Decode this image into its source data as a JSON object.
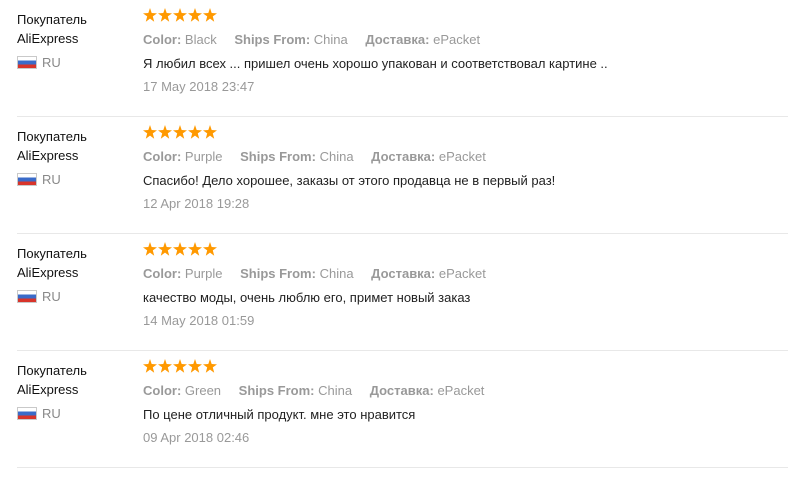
{
  "colors": {
    "star": "#ff9900",
    "muted_text": "#999999",
    "body_text": "#222222",
    "divider": "#e8e8e8"
  },
  "labels": {
    "color": "Color:",
    "ships_from": "Ships From:",
    "delivery": "Доставка:"
  },
  "reviews": [
    {
      "buyer_line1": "Покупатель",
      "buyer_line2": "AliExpress",
      "country_code": "RU",
      "rating": 5,
      "color": "Black",
      "ships_from": "China",
      "delivery": "ePacket",
      "text": "Я любил всех ... пришел очень хорошо упакован и соответствовал картине ..",
      "date": "17 May 2018 23:47"
    },
    {
      "buyer_line1": "Покупатель",
      "buyer_line2": "AliExpress",
      "country_code": "RU",
      "rating": 5,
      "color": "Purple",
      "ships_from": "China",
      "delivery": "ePacket",
      "text": "Спасибо! Дело хорошее, заказы от этого продавца не в первый раз!",
      "date": "12 Apr 2018 19:28"
    },
    {
      "buyer_line1": "Покупатель",
      "buyer_line2": "AliExpress",
      "country_code": "RU",
      "rating": 5,
      "color": "Purple",
      "ships_from": "China",
      "delivery": "ePacket",
      "text": "качество моды, очень люблю его, примет новый заказ",
      "date": "14 May 2018 01:59"
    },
    {
      "buyer_line1": "Покупатель",
      "buyer_line2": "AliExpress",
      "country_code": "RU",
      "rating": 5,
      "color": "Green",
      "ships_from": "China",
      "delivery": "ePacket",
      "text": "По цене отличный продукт. мне это нравится",
      "date": "09 Apr 2018 02:46"
    }
  ]
}
